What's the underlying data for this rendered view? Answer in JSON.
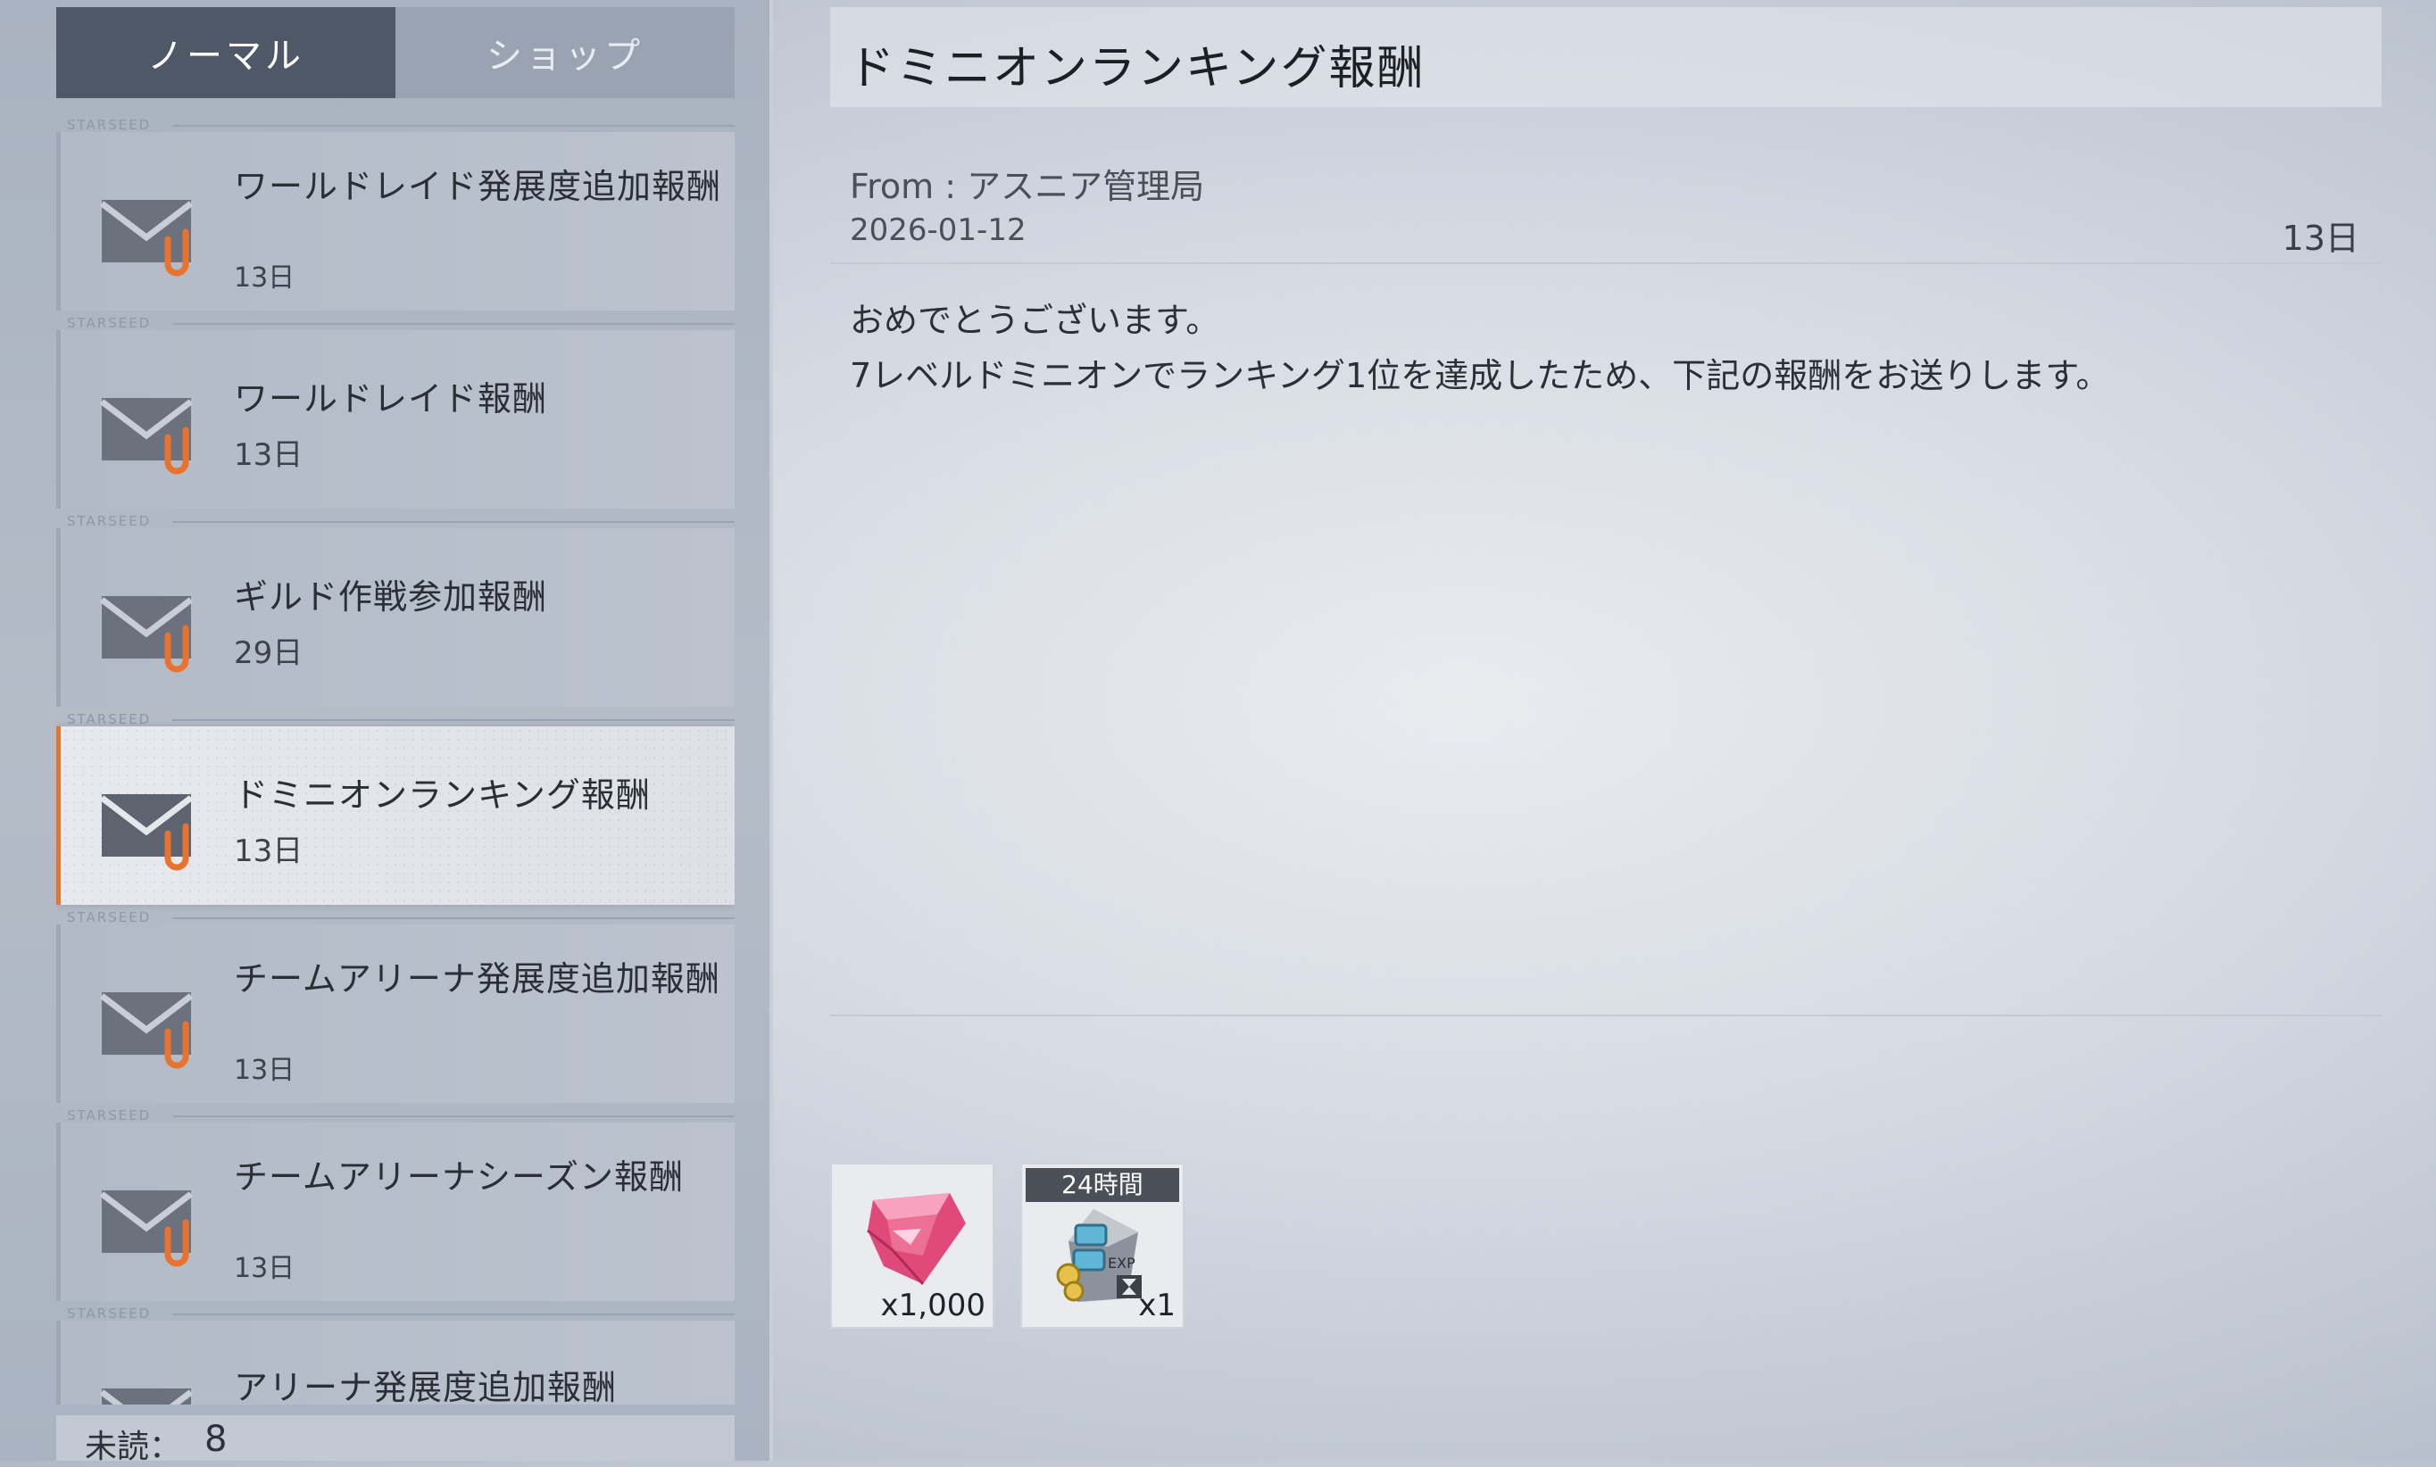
{
  "tabs": [
    {
      "label": "ノーマル"
    },
    {
      "label": "ショップ"
    }
  ],
  "mail_tag": "STARSEED",
  "mails": [
    {
      "title": "ワールドレイド発展度追加報酬",
      "age": "13日"
    },
    {
      "title": "ワールドレイド報酬",
      "age": "13日"
    },
    {
      "title": "ギルド作戦参加報酬",
      "age": "29日"
    },
    {
      "title": "ドミニオンランキング報酬",
      "age": "13日"
    },
    {
      "title": "チームアリーナ発展度追加報酬",
      "age": "13日"
    },
    {
      "title": "チームアリーナシーズン報酬",
      "age": "13日"
    },
    {
      "title": "アリーナ発展度追加報酬",
      "age": ""
    }
  ],
  "selected_index": 3,
  "unread": {
    "label": "未読：",
    "count": "8"
  },
  "detail": {
    "title": "ドミニオンランキング報酬",
    "from": "From : アスニア管理局",
    "date": "2026-01-12",
    "days_left": "13日",
    "body_line1": "おめでとうございます。",
    "body_line2": "7レベルドミニオンでランキング1位を達成したため、下記の報酬をお送りします。"
  },
  "rewards": [
    {
      "icon": "pink-gem-icon",
      "qty": "x1,000"
    },
    {
      "icon": "exp-booster-icon",
      "qty": "x1",
      "badge": "24時間"
    }
  ],
  "colors": {
    "accent": "#e8732e",
    "tab_active": "#4f5866",
    "gem": "#e04a7a"
  }
}
